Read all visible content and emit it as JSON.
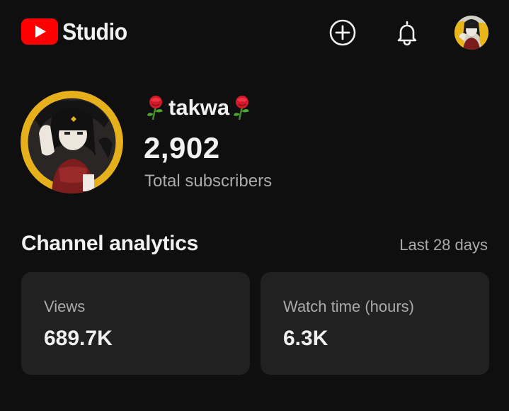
{
  "app": {
    "logo_text": "Studio",
    "brand_color": "#ff0000"
  },
  "topbar": {
    "icons": [
      "create-icon",
      "bell-icon"
    ],
    "avatar_icon": "avatar"
  },
  "channel": {
    "name": "takwa",
    "name_decoration": "rose-emoji",
    "subscriber_count": "2,902",
    "subscriber_label": "Total subscribers"
  },
  "analytics": {
    "title": "Channel analytics",
    "period": "Last 28 days",
    "cards": [
      {
        "label": "Views",
        "value": "689.7K"
      },
      {
        "label": "Watch time (hours)",
        "value": "6.3K"
      }
    ]
  },
  "colors": {
    "background": "#0f0f0f",
    "card": "#212121",
    "text_primary": "#f1f1f1",
    "text_secondary": "#aaaaaa"
  }
}
